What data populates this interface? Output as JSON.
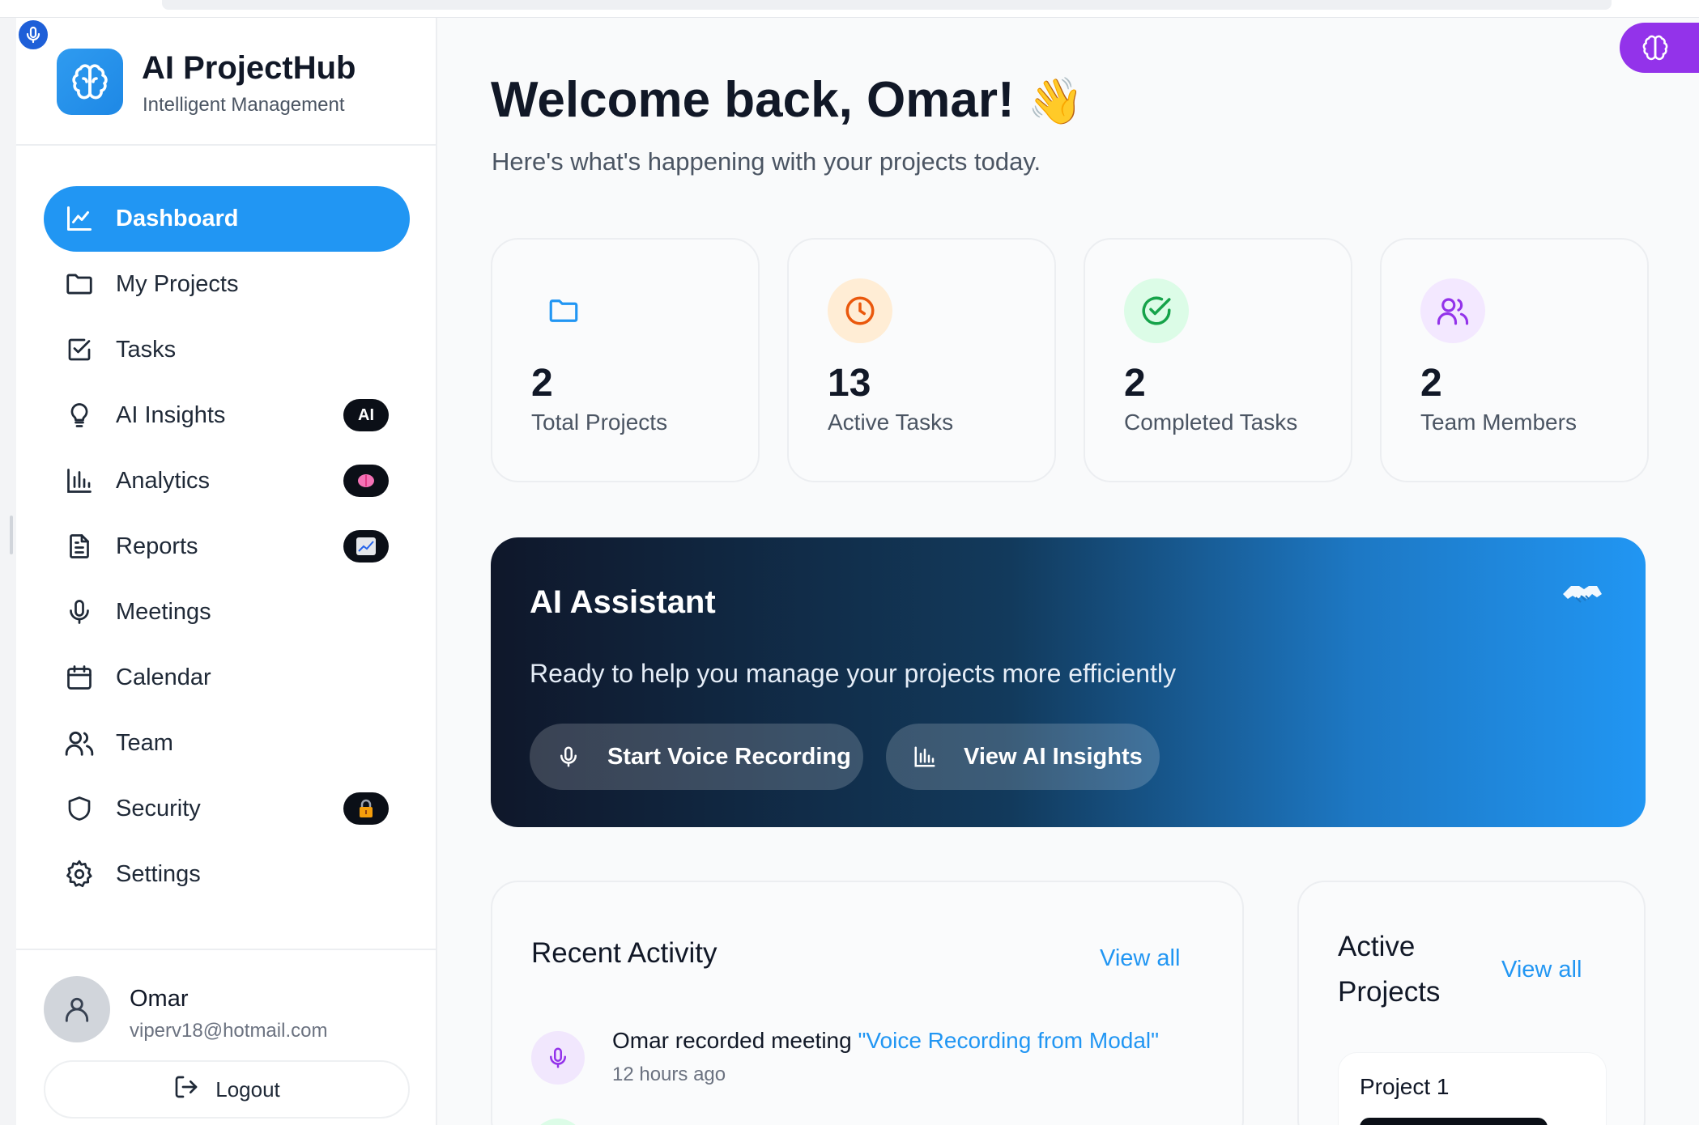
{
  "app": {
    "name": "AI ProjectHub",
    "tagline": "Intelligent Management"
  },
  "sidebar": {
    "items": [
      {
        "label": "Dashboard",
        "icon": "chart-line-icon",
        "active": true
      },
      {
        "label": "My Projects",
        "icon": "folder-icon"
      },
      {
        "label": "Tasks",
        "icon": "checkbox-icon"
      },
      {
        "label": "AI Insights",
        "icon": "lightbulb-icon",
        "badge": "AI"
      },
      {
        "label": "Analytics",
        "icon": "bar-chart-icon",
        "badge_icon": "brain-emoji-icon"
      },
      {
        "label": "Reports",
        "icon": "file-text-icon",
        "badge_icon": "chart-emoji-icon"
      },
      {
        "label": "Meetings",
        "icon": "mic-icon"
      },
      {
        "label": "Calendar",
        "icon": "calendar-icon"
      },
      {
        "label": "Team",
        "icon": "users-icon"
      },
      {
        "label": "Security",
        "icon": "shield-icon",
        "badge_icon": "lock-emoji-icon"
      },
      {
        "label": "Settings",
        "icon": "gear-icon"
      }
    ]
  },
  "user": {
    "name": "Omar",
    "email": "viperv18@hotmail.com",
    "logout_label": "Logout"
  },
  "header": {
    "welcome": "Welcome back, Omar!",
    "wave": "👋",
    "subtitle": "Here's what's happening with your projects today."
  },
  "stats": [
    {
      "value": "2",
      "label": "Total Projects",
      "icon": "folder-icon",
      "color": "#2196f3"
    },
    {
      "value": "13",
      "label": "Active Tasks",
      "icon": "clock-icon",
      "color": "#ea580c"
    },
    {
      "value": "2",
      "label": "Completed Tasks",
      "icon": "check-circle-icon",
      "color": "#16a34a"
    },
    {
      "value": "2",
      "label": "Team Members",
      "icon": "users-icon",
      "color": "#9333ea"
    }
  ],
  "assistant": {
    "title": "AI Assistant",
    "subtitle": "Ready to help you manage your projects more efficiently",
    "record_button": "Start Voice Recording",
    "insights_button": "View AI Insights"
  },
  "recent_activity": {
    "title": "Recent Activity",
    "view_all": "View all",
    "items": [
      {
        "prefix": "Omar recorded meeting ",
        "quote": "\"Voice Recording from Modal\"",
        "time": "12 hours ago"
      }
    ]
  },
  "active_projects": {
    "title_line1": "Active",
    "title_line2": "Projects",
    "view_all": "View all",
    "items": [
      {
        "name": "Project 1"
      }
    ]
  },
  "colors": {
    "accent": "#2196f3",
    "brand_purple": "#9333ea"
  }
}
